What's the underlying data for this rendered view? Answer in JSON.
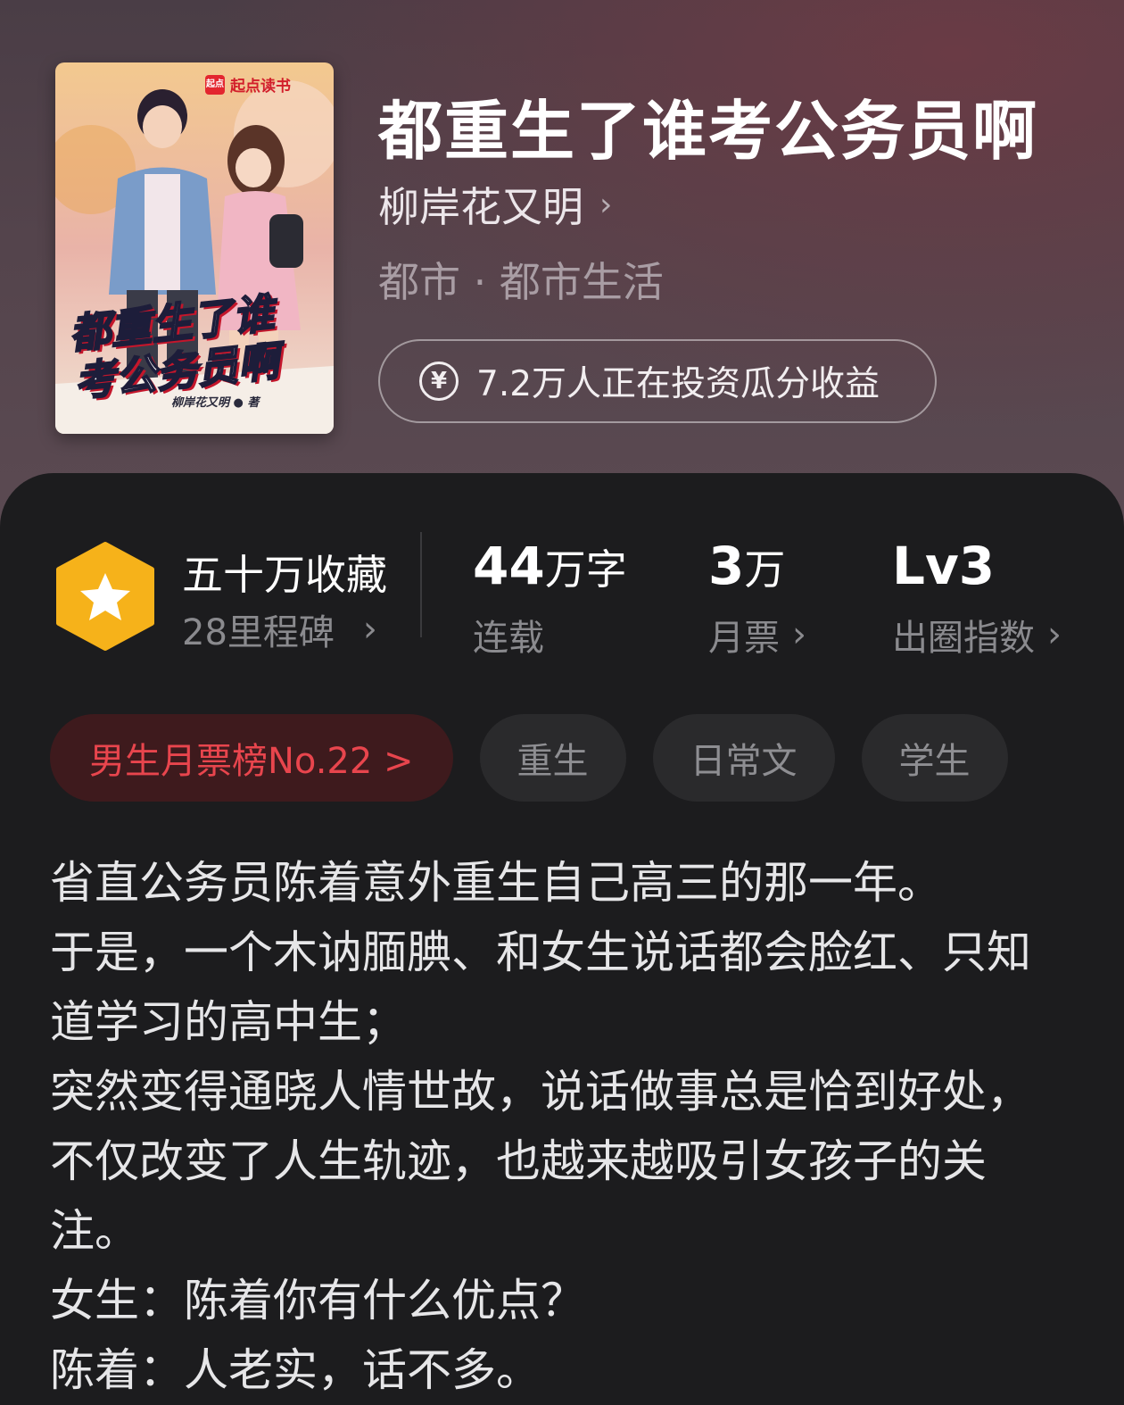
{
  "book": {
    "title": "都重生了谁考公务员啊",
    "author": "柳岸花又明",
    "genre": "都市 · 都市生活",
    "invest_text": "7.2万人正在投资瓜分收益"
  },
  "cover": {
    "brand": "起点读书",
    "brand_logo": "起点",
    "title_lines": [
      "都重生了谁",
      "考公务员啊"
    ],
    "author_line": "柳岸花又明 ● 著"
  },
  "stats": {
    "collect": {
      "main": "五十万收藏",
      "sub": "28里程碑"
    },
    "words": {
      "num": "44",
      "unit": "万字",
      "label": "连载"
    },
    "votes": {
      "num": "3",
      "unit": "万",
      "label": "月票"
    },
    "index": {
      "num": "Lv3",
      "label": "出圈指数"
    }
  },
  "tags": {
    "rank": "男生月票榜No.22 >",
    "items": [
      "重生",
      "日常文",
      "学生"
    ]
  },
  "description": [
    "省直公务员陈着意外重生自己高三的那一年。",
    "于是，一个木讷腼腆、和女生说话都会脸红、只知道学习的高中生；",
    "突然变得通晓人情世故，说话做事总是恰到好处，不仅改变了人生轨迹，也越来越吸引女孩子的关注。",
    "女生：陈着你有什么优点？",
    "陈着：人老实，话不多。"
  ],
  "colors": {
    "accent_red": "#e8454d",
    "badge_yellow": "#f6b21a",
    "panel_bg": "#1c1c1e"
  },
  "icons": {
    "yen": "yen-circle-icon",
    "chevron": "chevron-right-icon",
    "badge": "star-hexagon-icon"
  }
}
